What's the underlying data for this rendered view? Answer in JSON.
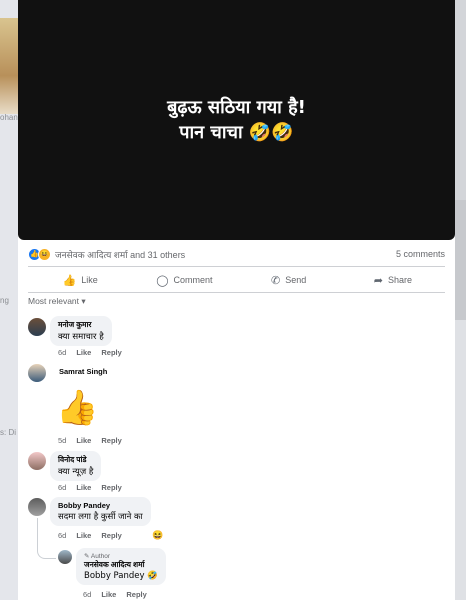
{
  "background": {
    "left_fragment_1": "ohan",
    "left_fragment_2": "ng",
    "left_fragment_3": "s: Di"
  },
  "post": {
    "video_line_1": "बुढ़ऊ सठिया गया है!",
    "video_line_2": "पान चाचा 🤣🤣"
  },
  "reactions": {
    "like_icon": "👍",
    "haha_icon": "😆",
    "summary": "जनसेवक आदित्य शर्मा and 31 others",
    "comment_count": "5 comments"
  },
  "actions": [
    {
      "label": "Like",
      "icon": "thumbs-up-icon",
      "glyph": "👍"
    },
    {
      "label": "Comment",
      "icon": "comment-icon",
      "glyph": "◯"
    },
    {
      "label": "Send",
      "icon": "whatsapp-icon",
      "glyph": "✆"
    },
    {
      "label": "Share",
      "icon": "share-icon",
      "glyph": "➦"
    }
  ],
  "sort_label": "Most relevant",
  "comments": [
    {
      "name": "मनोज कुमार",
      "text": "क्या समाचार है",
      "time": "6d",
      "like": "Like",
      "reply": "Reply"
    },
    {
      "name": "Samrat Singh",
      "sticker": "👍",
      "time": "5d",
      "like": "Like",
      "reply": "Reply"
    },
    {
      "name": "विनोद पांडे",
      "text": "क्या न्यूज़ है",
      "time": "6d",
      "like": "Like",
      "reply": "Reply"
    },
    {
      "name": "Bobby Pandey",
      "text": "सदमा लगा है कुर्सी जाने का",
      "time": "6d",
      "like": "Like",
      "reply": "Reply",
      "reaction": "😆"
    },
    {
      "author_label": "Author",
      "name": "जनसेवक आदित्य शर्मा",
      "text": "Bobby Pandey 🤣",
      "time": "6d",
      "like": "Like",
      "reply": "Reply"
    }
  ],
  "colors": {
    "accent": "#1877f2",
    "video_bg": "#111111",
    "bubble": "#f0f2f5"
  }
}
